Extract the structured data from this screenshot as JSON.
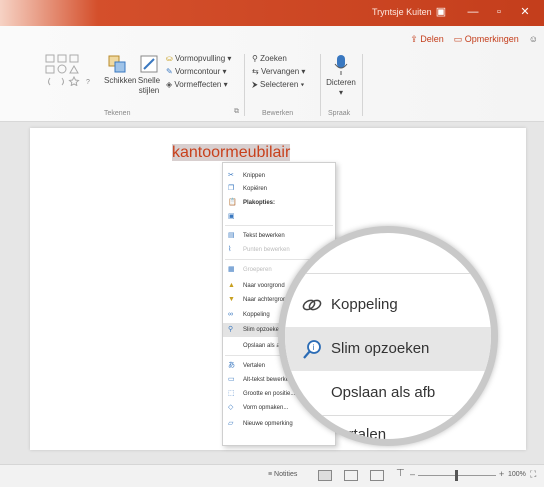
{
  "title_bar": {
    "user": "Tryntsje Kuiten"
  },
  "ribbon": {
    "share": "Delen",
    "comments": "Opmerkingen",
    "arrange": "Schikken",
    "quick_styles_line1": "Snelle",
    "quick_styles_line2": "stijlen",
    "shape_fill": "Vormopvulling",
    "shape_outline": "Vormcontour",
    "shape_effects": "Vormeffecten",
    "find": "Zoeken",
    "replace": "Vervangen",
    "select": "Selecteren",
    "dictate": "Dicteren",
    "groups": {
      "drawing": "Tekenen",
      "editing": "Bewerken",
      "voice": "Spraak"
    }
  },
  "slide": {
    "selected_text": "kantoormeubilair"
  },
  "context_menu": {
    "items": [
      {
        "label": "Knippen",
        "icon": "scissors-icon"
      },
      {
        "label": "Kopiëren",
        "icon": "copy-icon"
      },
      {
        "label": "Plakopties:",
        "icon": "clipboard-icon"
      },
      {
        "label": "",
        "icon": "paste-option-icon"
      },
      {
        "label": "Tekst bewerken",
        "icon": "edit-text-icon"
      },
      {
        "label": "Punten bewerken",
        "icon": "edit-points-icon"
      },
      {
        "label": "Groeperen",
        "icon": "group-icon"
      },
      {
        "label": "Naar voorgrond",
        "icon": "bring-forward-icon"
      },
      {
        "label": "Naar achtergrond",
        "icon": "send-backward-icon"
      },
      {
        "label": "Koppeling",
        "icon": "link-icon"
      },
      {
        "label": "Slim opzoeken",
        "icon": "smart-lookup-icon",
        "selected": true
      },
      {
        "label": "Opslaan als afbeelding...",
        "icon": ""
      },
      {
        "label": "Vertalen",
        "icon": "translate-icon"
      },
      {
        "label": "Alt-tekst bewerken...",
        "icon": "alt-text-icon"
      },
      {
        "label": "Grootte en positie...",
        "icon": "size-position-icon"
      },
      {
        "label": "Vorm opmaken...",
        "icon": "format-shape-icon"
      },
      {
        "label": "Nieuwe opmerking",
        "icon": "comment-icon"
      }
    ]
  },
  "magnifier": {
    "items": [
      {
        "label": "Koppeling"
      },
      {
        "label": "Slim opzoeken",
        "selected": true
      },
      {
        "label": "Opslaan als afb"
      },
      {
        "label": "Vertalen"
      }
    ]
  },
  "status_bar": {
    "notes": "Notities",
    "zoom": "100%",
    "zoom_level": 1.0
  },
  "colors": {
    "accent": "#c43e1c",
    "selection": "#e3e3e3"
  }
}
